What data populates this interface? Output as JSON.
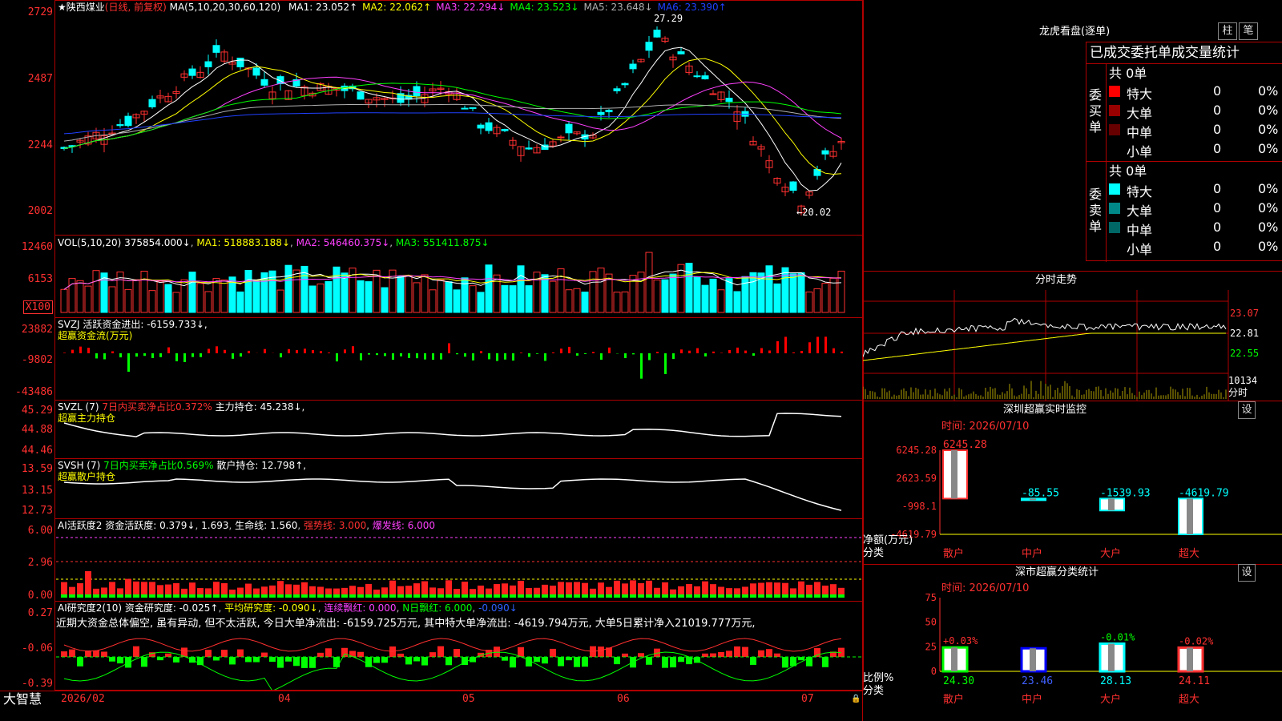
{
  "colors": {
    "up": "#ff3030",
    "down": "#00ffff",
    "ma1": "#ffffff",
    "ma2": "#ffff00",
    "ma3": "#ff40ff",
    "ma4": "#00ff00",
    "ma5": "#b0b0b0",
    "ma6": "#2040ff",
    "grid": "#b00000"
  },
  "main": {
    "stock": "★陕西煤业",
    "mode": "(日线, 前复权)",
    "ma_prefix": "MA(5,10,20,30,60,120)",
    "ma": [
      {
        "label": "MA1: 23.052↑",
        "color": "#ffffff"
      },
      {
        "label": "MA2: 22.062↑",
        "color": "#ffff00"
      },
      {
        "label": "MA3: 22.294↓",
        "color": "#ff40ff"
      },
      {
        "label": "MA4: 23.523↓",
        "color": "#00ff00"
      },
      {
        "label": "MA5: 23.648↓",
        "color": "#b0b0b0"
      },
      {
        "label": "MA6: 23.390↑",
        "color": "#2040ff"
      }
    ],
    "yticks": [
      "2729",
      "2487",
      "2244",
      "2002"
    ],
    "high_label": "27.29",
    "low_label": "←20.02"
  },
  "vol": {
    "title": "VOL(5,10,20)",
    "value": "375854.000↓",
    "ma1": "MA1: 518883.188↓",
    "ma2": "MA2: 546460.375↓",
    "ma3": "MA3: 551411.875↓",
    "yticks": [
      "12460",
      "6153"
    ],
    "unit": "X100"
  },
  "svzj": {
    "title": "SVZJ  活跃资金进出: -6159.733↓,",
    "sub": "超赢资金流(万元)",
    "yticks": [
      "23882",
      "-9802",
      "-43486"
    ]
  },
  "svzl": {
    "title": "SVZL (7)",
    "share": "7日内买卖净占比0.372%",
    "hold": "主力持仓: 45.238↓,",
    "sub": "超赢主力持仓",
    "yticks": [
      "45.29",
      "44.88",
      "44.46"
    ]
  },
  "svsh": {
    "title": "SVSH (7)",
    "share": "7日内买卖净占比0.569%",
    "hold": "散户持仓: 12.798↑,",
    "sub": "超赢散户持仓",
    "yticks": [
      "13.59",
      "13.15",
      "12.73"
    ]
  },
  "ai1": {
    "title": "AI活跃度2",
    "act": "资金活跃度: 0.379↓",
    "v2": "1.693",
    "life": "生命线: 1.560",
    "strong": "强势线: 3.000",
    "burst": "爆发线: 6.000",
    "yticks": [
      "6.00",
      "2.96",
      "0.00"
    ]
  },
  "ai2": {
    "title": "AI研究度2(10)",
    "res": "资金研究度: -0.025↑",
    "avg": "平均研究度: -0.090↓",
    "red1": "连续飘红: 0.000",
    "red2": "N日飘红: 6.000",
    "last": "-0.090↓",
    "yticks": [
      "0.27",
      "-0.06",
      "-0.39"
    ],
    "comment": "近期大资金总体偏空, 虽有异动, 但不太活跃, 今日大单净流出: -6159.725万元, 其中特大单净流出: -4619.794万元, 大单5日累计净入21019.777万元,"
  },
  "xaxis": {
    "brand": "大智慧",
    "labels": [
      {
        "t": "2026/02",
        "x": 76
      },
      {
        "t": "04",
        "x": 347
      },
      {
        "t": "05",
        "x": 577
      },
      {
        "t": "06",
        "x": 770
      },
      {
        "t": "07",
        "x": 1000
      }
    ]
  },
  "right": {
    "lhb_title": "龙虎看盘(逐单)",
    "tab_bar": "柱",
    "tab_pen": "笔",
    "deal_title": "已成交委托单成交量统计",
    "buy_side": "委买单",
    "sell_side": "委卖单",
    "buy_total": "共 0单",
    "sell_total": "共 0单",
    "buy_rows": [
      {
        "name": "特大",
        "v": "0",
        "p": "0%",
        "c": "#ff0000"
      },
      {
        "name": "大单",
        "v": "0",
        "p": "0%",
        "c": "#990000"
      },
      {
        "name": "中单",
        "v": "0",
        "p": "0%",
        "c": "#660000"
      },
      {
        "name": "小单",
        "v": "0",
        "p": "0%",
        "c": ""
      }
    ],
    "sell_rows": [
      {
        "name": "特大",
        "v": "0",
        "p": "0%",
        "c": "#00ffff"
      },
      {
        "name": "大单",
        "v": "0",
        "p": "0%",
        "c": "#008888"
      },
      {
        "name": "中单",
        "v": "0",
        "p": "0%",
        "c": "#006666"
      },
      {
        "name": "小单",
        "v": "0",
        "p": "0%",
        "c": ""
      }
    ],
    "fs_title": "分时走势",
    "fs_prices": [
      "23.07",
      "22.81",
      "22.55"
    ],
    "fs_vol": "10134",
    "fs_unit": "分时",
    "mon_title": "深圳超赢实时监控",
    "mon_set": "设",
    "mon_time": "时间: 2026/07/10",
    "mon_yticks": [
      "6245.28",
      "2623.59",
      "-998.1",
      "-4619.79"
    ],
    "mon_unit": "净额(万元)",
    "mon_cat_label": "分类",
    "mon_bars": [
      {
        "name": "散户",
        "value": 6245.28,
        "label": "6245.28"
      },
      {
        "name": "中户",
        "value": -85.55,
        "label": "-85.55"
      },
      {
        "name": "大户",
        "value": -1539.93,
        "label": "-1539.93"
      },
      {
        "name": "超大",
        "value": -4619.79,
        "label": "-4619.79"
      }
    ],
    "cls_title": "深市超赢分类统计",
    "cls_set": "设",
    "cls_time": "时间: 2026/07/10",
    "cls_yticks": [
      "75",
      "50",
      "25",
      "0"
    ],
    "cls_unit": "比例%",
    "cls_cat_label": "分类",
    "cls_bars": [
      {
        "name": "散户",
        "value": 24.3,
        "label": "24.30",
        "chg": "+0.03%"
      },
      {
        "name": "中户",
        "value": 23.46,
        "label": "23.46",
        "chg": ""
      },
      {
        "name": "大户",
        "value": 28.13,
        "label": "28.13",
        "chg": "-0.01%"
      },
      {
        "name": "超大",
        "value": 24.11,
        "label": "24.11",
        "chg": "-0.02%"
      }
    ]
  },
  "chart_data": [
    {
      "type": "candlestick",
      "title": "陕西煤业 (日线, 前复权)",
      "ylim": [
        20.02,
        27.29
      ],
      "high": 27.29,
      "low": 20.02,
      "series_ma": [
        "MA1 23.052",
        "MA2 22.062",
        "MA3 22.294",
        "MA4 23.523",
        "MA5 23.648",
        "MA6 23.390"
      ]
    },
    {
      "type": "bar",
      "title": "深圳超赢实时监控",
      "categories": [
        "散户",
        "中户",
        "大户",
        "超大"
      ],
      "values": [
        6245.28,
        -85.55,
        -1539.93,
        -4619.79
      ],
      "ylim": [
        -4619.79,
        6245.28
      ]
    },
    {
      "type": "bar",
      "title": "深市超赢分类统计",
      "categories": [
        "散户",
        "中户",
        "大户",
        "超大"
      ],
      "values": [
        24.3,
        23.46,
        28.13,
        24.11
      ],
      "ylim": [
        0,
        75
      ]
    }
  ]
}
